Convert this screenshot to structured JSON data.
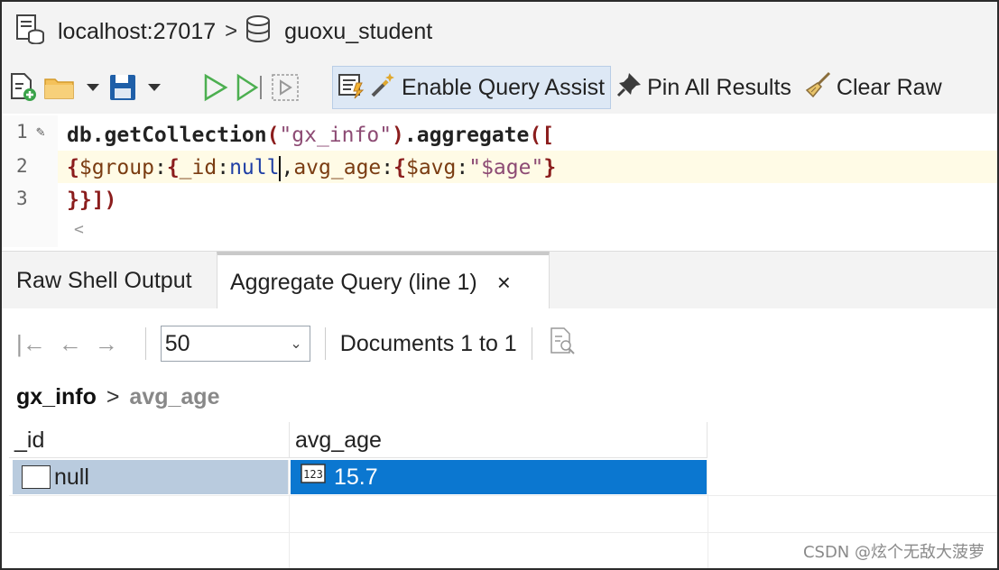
{
  "breadcrumb": {
    "server": "localhost:27017",
    "database": "guoxu_student"
  },
  "toolbar": {
    "enable_query_assist": "Enable Query Assist",
    "pin_all_results": "Pin All Results",
    "clear_raw": "Clear Raw"
  },
  "editor": {
    "line_numbers": [
      "1",
      "2",
      "3"
    ],
    "line1": {
      "fn": "db.getCollection",
      "open": "(",
      "str": "\"gx_info\"",
      "close": ")",
      "agg": ".aggregate",
      "open2": "(["
    },
    "line2": {
      "lb1": "{",
      "group": "$group",
      "colon1": ":",
      "lb2": "{",
      "id": "_id",
      "colon2": ":",
      "null": "null",
      "comma": ",",
      "avgage": "avg_age",
      "colon3": ":",
      "lb3": "{",
      "avg": "$avg",
      "colon4": ":",
      "field": "\"$age\"",
      "rb": "}"
    },
    "line3": "}}])",
    "scroll_hint": "<"
  },
  "tabs": {
    "raw_shell_output": "Raw Shell Output",
    "aggregate_query": "Aggregate Query (line 1)",
    "close_symbol": "×"
  },
  "pager": {
    "first": "|←",
    "prev": "←",
    "next": "→",
    "page_size": "50",
    "range_text": "Documents 1 to 1"
  },
  "result_path": {
    "collection": "gx_info",
    "separator": ">",
    "field": "avg_age"
  },
  "grid": {
    "columns": [
      "_id",
      "avg_age"
    ],
    "rows": [
      {
        "id": "null",
        "avg_age": "15.7"
      }
    ]
  },
  "watermark": "CSDN @炫个无敌大菠萝",
  "colors": {
    "selection": "#0b77d0",
    "row_selected": "#b9cbde",
    "query_assist_bg": "#dde8f5",
    "run_green": "#4caf50"
  },
  "icons": [
    "server-icon",
    "database-icon",
    "new-file-icon",
    "folder-icon",
    "save-icon",
    "run-icon",
    "run-step-icon",
    "run-selection-icon",
    "query-assist-icon",
    "wand-icon",
    "pin-icon",
    "broom-icon",
    "checkbox-icon",
    "number-type-icon",
    "query-profiler-icon"
  ]
}
